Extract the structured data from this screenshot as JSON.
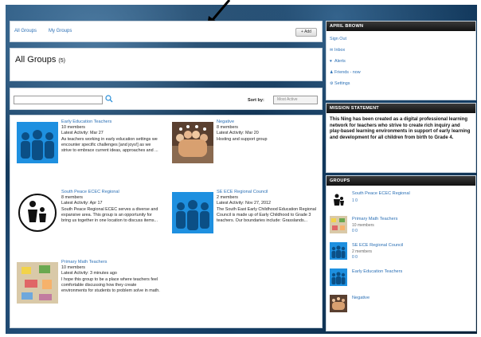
{
  "header": {
    "nav_all_groups": "All Groups",
    "nav_my_groups": "My Groups",
    "add_button": "+ Add"
  },
  "page": {
    "title": "All Groups",
    "count": "(5)"
  },
  "filter": {
    "sort_label": "Sort by:",
    "sort_value": "Most Active"
  },
  "groups": [
    {
      "name": "Early Education Teachers",
      "members": "10 members",
      "activity": "Latest Activity: Mar 27",
      "description": "As teachers working in early education settings we encounter specific challenges [and joys!] as we strive to embrace current ideas, approaches and ..."
    },
    {
      "name": "Negative",
      "members": "8 members",
      "activity": "Latest Activity: Mar 20",
      "description": "Hosting and support group"
    },
    {
      "name": "South Peace ECEC Regional",
      "members": "8 members",
      "activity": "Latest Activity: Apr 17",
      "description": "South Peace Regional ECEC serves a diverse and expansive area. This group is an opportunity for bring us together in one location to discuss items..."
    },
    {
      "name": "SE ECE Regional Council",
      "members": "2 members",
      "activity": "Latest Activity: Nov 27, 2012",
      "description": "The South East Early Childhood Education Regional Council is made up of Early Childhood to Grade 3 teachers.  Our boundaries include: Grasslands..."
    },
    {
      "name": "Primary Math Teachers",
      "members": "10 members",
      "activity": "Latest Activity: 3 minutes ago",
      "description": "I hope this group to be a place where teachers feel comfortable discussing how they create environments for students to problem solve in math."
    }
  ],
  "sidebar": {
    "user_name": "APRIL BROWN",
    "menu": [
      "Sign Out",
      "Inbox",
      "Alerts",
      "Friends - now",
      "Settings"
    ],
    "mission_title": "MISSION STATEMENT",
    "mission_text": "This Ning has been created as a digital professional learning network for teachers who strive to create rich inquiry and play-based learning environments in support of early learning and development for all children from birth to Grade 4.",
    "groups_title": "GROUPS",
    "group_list": [
      {
        "name": "South Peace ECEC Regional",
        "members": "",
        "stats": "1  0"
      },
      {
        "name": "Primary Math Teachers",
        "members": "10 members",
        "stats": "0  0"
      },
      {
        "name": "SE ECE Regional Council",
        "members": "2 members",
        "stats": "0  0"
      },
      {
        "name": "Early Education Teachers",
        "members": "",
        "stats": ""
      },
      {
        "name": "Negative",
        "members": "",
        "stats": ""
      }
    ]
  },
  "colors": {
    "link": "#2a6fb5",
    "thumb_blue": "#1e90e0",
    "header_dark": "#111111"
  }
}
